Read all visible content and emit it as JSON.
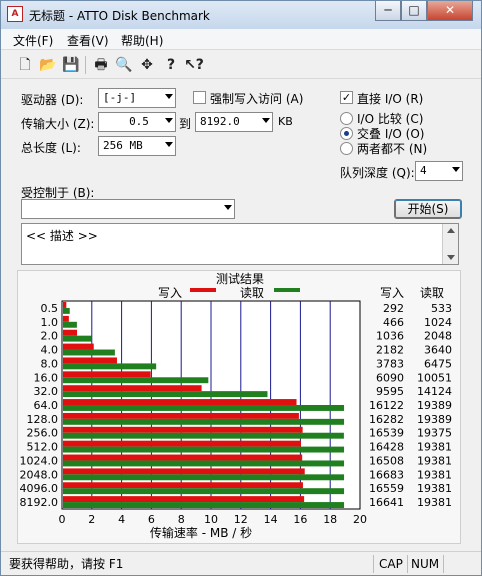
{
  "window": {
    "title": "无标题 - ATTO Disk Benchmark",
    "app_icon": "A"
  },
  "caption_buttons": {
    "minimize": "─",
    "maximize": "□",
    "close": "✕"
  },
  "menu": [
    "文件(F)",
    "查看(V)",
    "帮助(H)"
  ],
  "toolbar": [
    "new-file-icon",
    "open-folder-icon",
    "save-icon",
    "print-icon",
    "print-preview-icon",
    "move-icon",
    "help-icon",
    "context-help-icon"
  ],
  "toolbar_glyphs": [
    "🗋",
    "📂",
    "💾",
    "🖶",
    "🔍",
    "✥",
    "?",
    "↖?"
  ],
  "settings": {
    "drive_label": "驱动器 (D):",
    "drive_value": "[-j-]",
    "transfer_label": "传输大小 (Z):",
    "transfer_from": "0.5",
    "to_label": "到",
    "transfer_to": "8192.0",
    "kb_label": "KB",
    "total_label": "总长度 (L):",
    "total_value": "256 MB",
    "force_write_label": "强制写入访问 (A)",
    "force_write_checked": false,
    "direct_io_label": "直接 I/O (R)",
    "direct_io_checked": true,
    "io_compare_label": "I/O 比较 (C)",
    "overlap_io_label": "交叠 I/O (O)",
    "neither_label": "两者都不 (N)",
    "selected_io_mode": "overlap",
    "queue_label": "队列深度 (Q):",
    "queue_value": "4",
    "controlled_by_label": "受控制于 (B):",
    "controlled_by_value": "",
    "start_button": "开始(S)",
    "description": "<< 描述 >>"
  },
  "chart_data": {
    "type": "bar",
    "title": "测试结果",
    "legend": {
      "write": "写入",
      "read": "读取",
      "placement": "top-center"
    },
    "xlabel": "传输速率 - MB / 秒",
    "xlim": [
      0,
      20
    ],
    "xticks": [
      "0",
      "2",
      "4",
      "6",
      "8",
      "10",
      "12",
      "14",
      "16",
      "18",
      "20"
    ],
    "col_write_header": "写入",
    "col_read_header": "读取",
    "categories": [
      "0.5",
      "1.0",
      "2.0",
      "4.0",
      "8.0",
      "16.0",
      "32.0",
      "64.0",
      "128.0",
      "256.0",
      "512.0",
      "1024.0",
      "2048.0",
      "4096.0",
      "8192.0"
    ],
    "series": [
      {
        "name": "写入",
        "color": "#e01010",
        "values": [
          0.29,
          0.46,
          1.01,
          2.13,
          3.69,
          5.95,
          9.37,
          15.74,
          15.9,
          16.15,
          16.04,
          16.12,
          16.29,
          16.17,
          16.25
        ],
        "labels": [
          "292",
          "466",
          "1036",
          "2182",
          "3783",
          "6090",
          "9595",
          "16122",
          "16282",
          "16539",
          "16428",
          "16508",
          "16683",
          "16559",
          "16641"
        ]
      },
      {
        "name": "读取",
        "color": "#208020",
        "values": [
          0.52,
          1.0,
          2.0,
          3.55,
          6.32,
          9.82,
          13.79,
          18.93,
          18.93,
          18.92,
          18.93,
          18.93,
          18.93,
          18.93,
          18.93
        ],
        "labels": [
          "533",
          "1024",
          "2048",
          "3640",
          "6475",
          "10051",
          "14124",
          "19389",
          "19389",
          "19375",
          "19381",
          "19381",
          "19381",
          "19381",
          "19381"
        ]
      }
    ],
    "grid": true
  },
  "status": {
    "help_text": "要获得帮助，请按 F1",
    "cap": "CAP",
    "num": "NUM"
  }
}
